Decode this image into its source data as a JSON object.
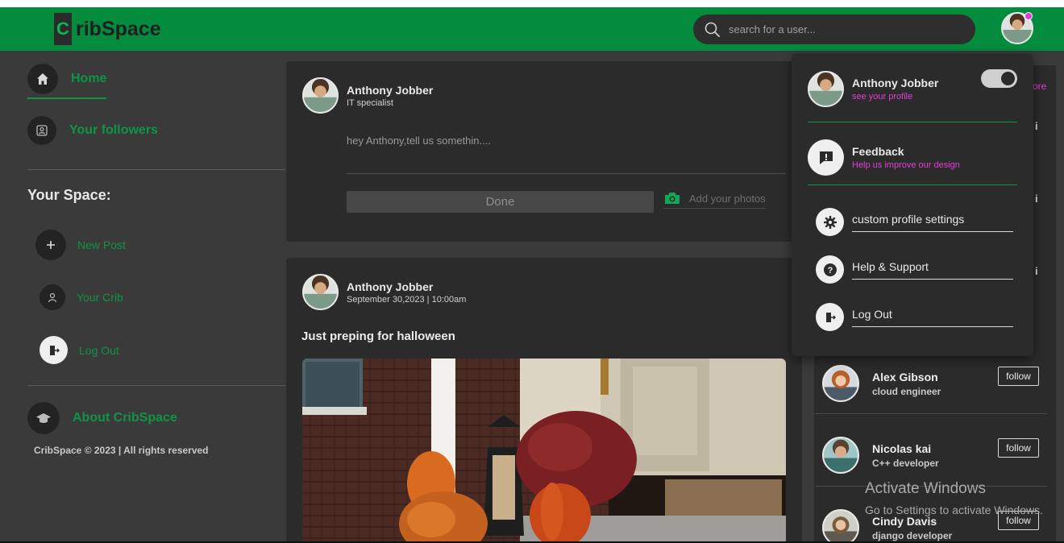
{
  "brand": {
    "logo_letter": "C",
    "name": "ribSpace"
  },
  "search": {
    "placeholder": "search for a user..."
  },
  "sidebar": {
    "home": "Home",
    "followers": "Your followers",
    "your_space_heading": "Your Space:",
    "new_post": "New Post",
    "your_crib": "Your Crib",
    "log_out": "Log Out",
    "about": "About CribSpace",
    "copyright": "CribSpace © 2023 | All rights reserved"
  },
  "composer": {
    "user_name": "Anthony Jobber",
    "user_role": "IT specialist",
    "prompt": "hey Anthony,tell us somethin....",
    "done_label": "Done",
    "add_photos_label": "Add your photos"
  },
  "post": {
    "user_name": "Anthony Jobber",
    "timestamp": "September 30,2023 | 10:00am",
    "text": "Just preping for halloween"
  },
  "dropdown": {
    "profile_name": "Anthony Jobber",
    "profile_link": "see your profile",
    "feedback_title": "Feedback",
    "feedback_sub": "Help us improve our design",
    "menu": [
      "custom profile settings",
      "Help & Support",
      "Log Out"
    ]
  },
  "right_peek": {
    "more": "ore",
    "i1": "i",
    "i2": "i",
    "i3": "i"
  },
  "suggestions": [
    {
      "name": "Alex Gibson",
      "role": "cloud engineer",
      "button": "follow"
    },
    {
      "name": "Nicolas kai",
      "role": "C++ developer",
      "button": "follow"
    },
    {
      "name": "Cindy Davis",
      "role": "django developer",
      "button": "follow"
    }
  ],
  "watermark": {
    "line1": "Activate Windows",
    "line2": "Go to Settings to activate Windows."
  },
  "colors": {
    "brand_green": "#038c3e",
    "nav_green": "#0f9446",
    "accent_pink": "#e23fd8",
    "panel_bg": "#2b2b2b",
    "page_bg": "#3a3a3a"
  }
}
